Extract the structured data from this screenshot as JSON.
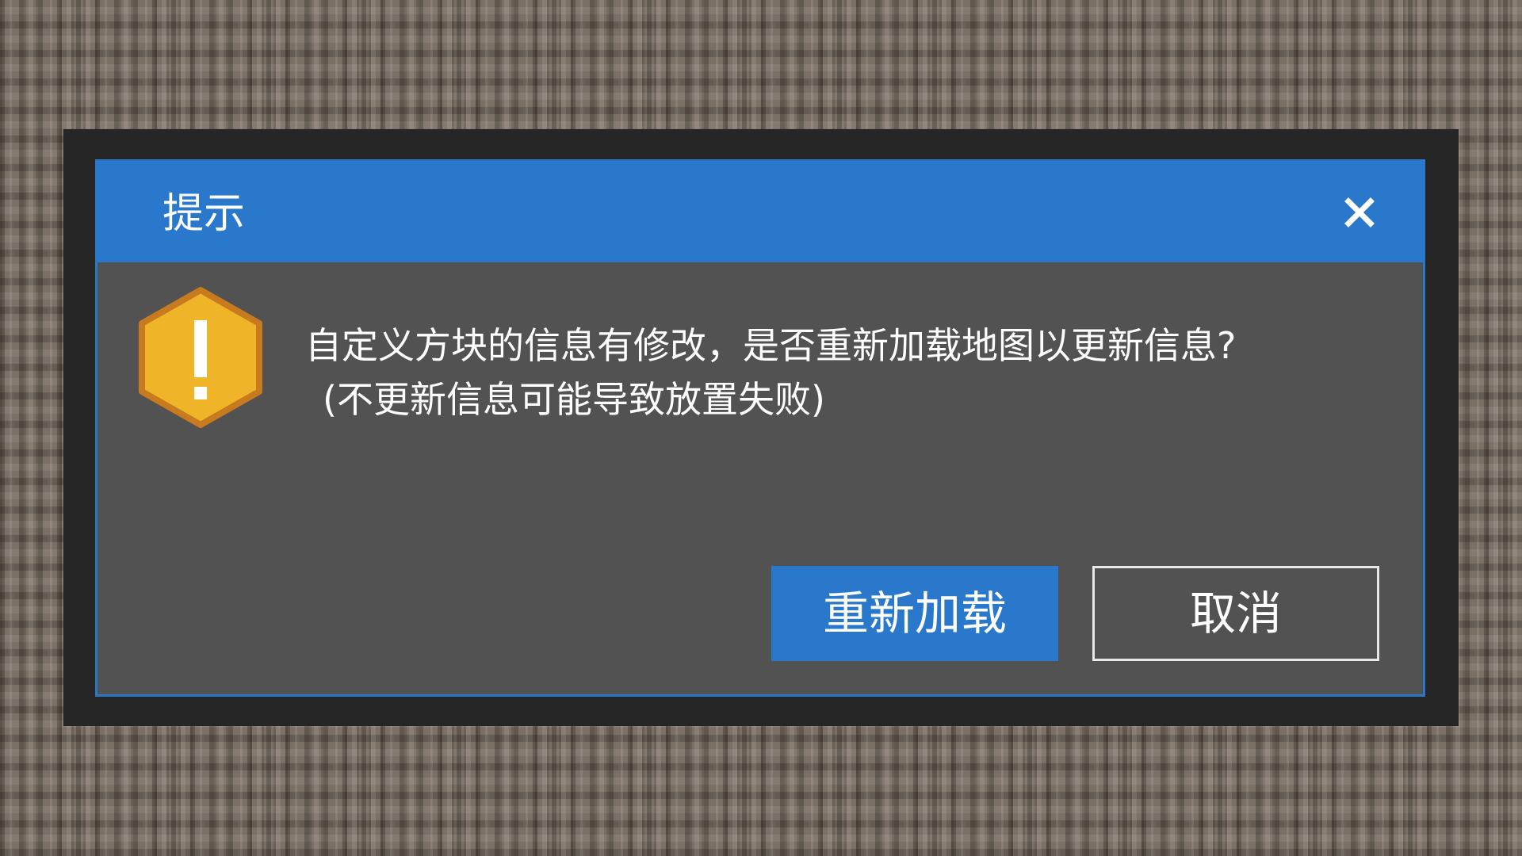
{
  "dialog": {
    "title": "提示",
    "message_line1": "自定义方块的信息有修改，是否重新加载地图以更新信息?",
    "message_line2": "(不更新信息可能导致放置失败)",
    "icons": {
      "close": "close-icon",
      "warning": "warning-icon"
    },
    "buttons": {
      "confirm_label": "重新加载",
      "cancel_label": "取消"
    }
  },
  "colors": {
    "accent": "#2a78cc",
    "dialog_body": "#525252",
    "frame": "#262626",
    "warning_fill": "#f0b428",
    "warning_border": "#c77a1e",
    "text": "#ffffff"
  }
}
